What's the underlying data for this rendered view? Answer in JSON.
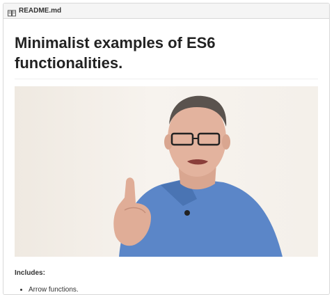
{
  "file_header": {
    "icon": "book-icon",
    "filename": "README.md"
  },
  "readme": {
    "title": "Minimalist examples of ES6 functionalities.",
    "includes_label": "Includes:",
    "items": [
      "Arrow functions."
    ]
  }
}
